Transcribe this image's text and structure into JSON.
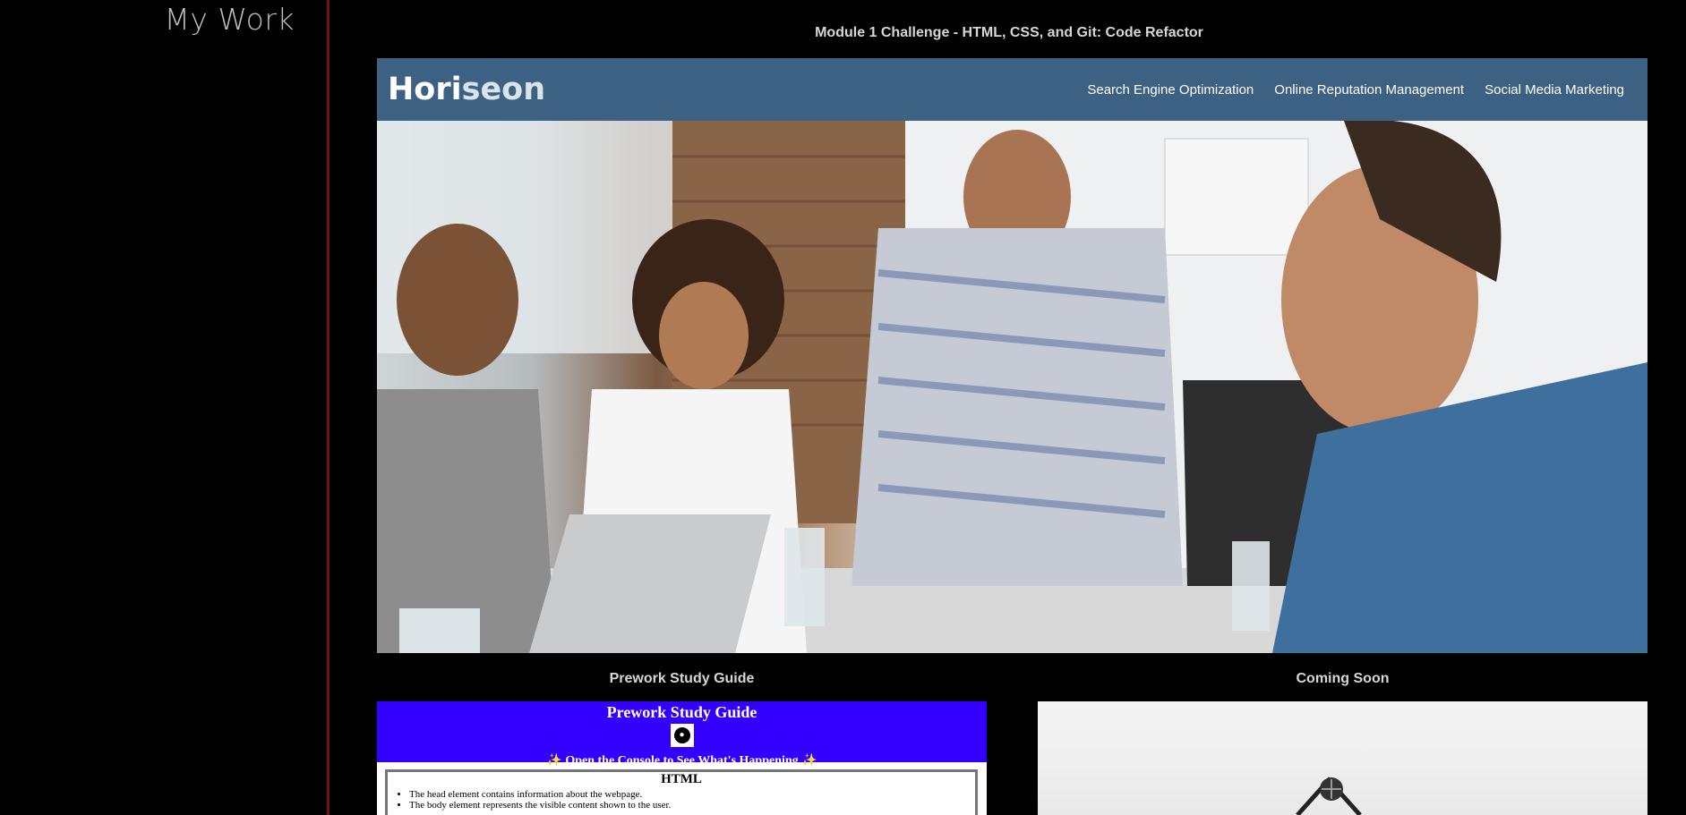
{
  "sidebar": {
    "title": "My Work"
  },
  "project": {
    "title": "Module 1 Challenge - HTML, CSS, and Git: Code Refactor",
    "logo_a": "Hori",
    "logo_b": "seon",
    "nav": [
      "Search Engine Optimization",
      "Online Reputation Management",
      "Social Media Marketing"
    ]
  },
  "cards": [
    {
      "title": "Prework Study Guide",
      "heading": "Prework Study Guide",
      "console": "✨ Open the Console to See What's Happening ✨",
      "section": "HTML",
      "items": [
        "The head element contains information about the webpage.",
        "The body element represents the visible content shown to the user."
      ]
    },
    {
      "title": "Coming Soon"
    }
  ]
}
